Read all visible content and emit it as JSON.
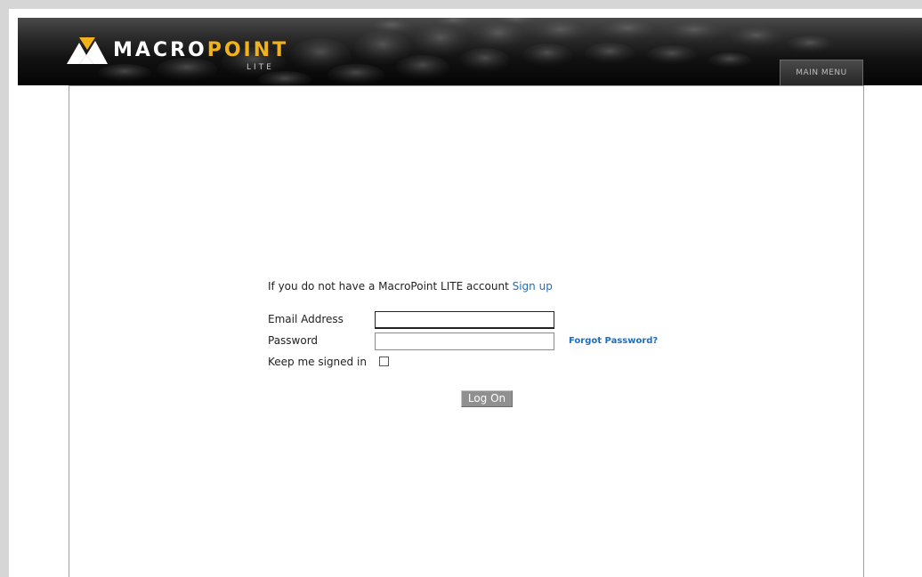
{
  "header": {
    "logo_primary": "MACRO",
    "logo_accent": "POINT",
    "logo_sub": "LITE",
    "main_menu_label": "MAIN MENU"
  },
  "login": {
    "intro_text": "If you do not have a MacroPoint LITE account ",
    "signup_link": "Sign up",
    "email_label": "Email Address",
    "email_value": "",
    "password_label": "Password",
    "password_value": "",
    "forgot_link": "Forgot Password?",
    "keep_signed_in_label": "Keep me signed in",
    "keep_signed_in_checked": false,
    "logon_button": "Log On"
  },
  "colors": {
    "brand_accent": "#f2b21c",
    "link": "#1a6fc4",
    "header_bg": "#0a0a0a"
  }
}
